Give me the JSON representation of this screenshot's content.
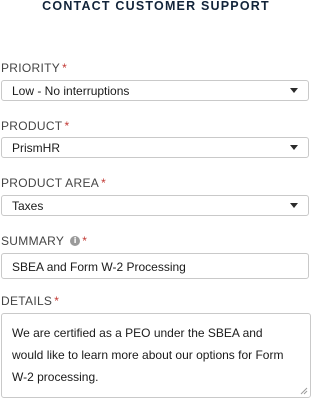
{
  "form": {
    "title": "CONTACT CUSTOMER SUPPORT",
    "required_marker": "*",
    "priority": {
      "label": "PRIORITY",
      "value": "Low - No interruptions"
    },
    "product": {
      "label": "PRODUCT",
      "value": "PrismHR"
    },
    "product_area": {
      "label": "PRODUCT AREA",
      "value": "Taxes"
    },
    "summary": {
      "label": "SUMMARY",
      "info_icon": "info-icon",
      "info_glyph": "i",
      "value": "SBEA and Form W-2 Processing"
    },
    "details": {
      "label": "DETAILS",
      "value": "We are certified as a PEO under the SBEA and would like to learn more about our options for Form W-2 processing."
    }
  },
  "colors": {
    "title": "#12243a",
    "required": "#c23934",
    "border": "#c9c9c9"
  }
}
